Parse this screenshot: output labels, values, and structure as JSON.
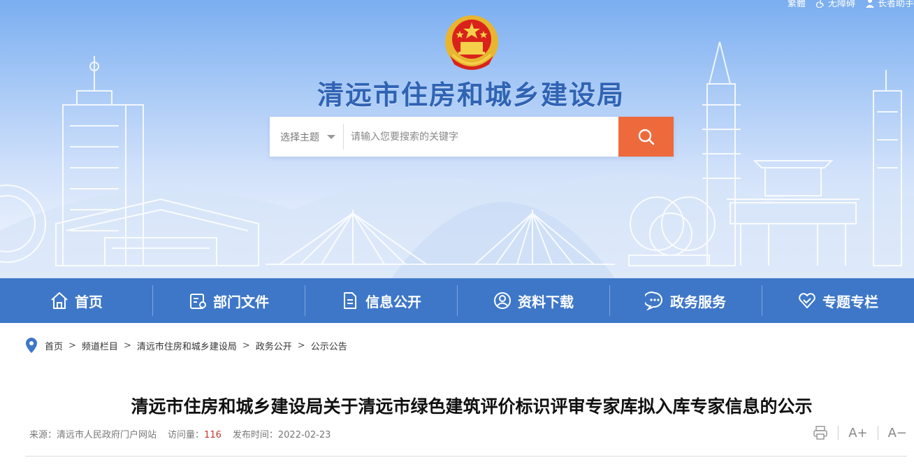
{
  "header": {
    "top_links": [
      {
        "label": "繁體",
        "icon": "traditional-chinese-icon"
      },
      {
        "label": "无障碍",
        "icon": "accessibility-icon"
      },
      {
        "label": "长者助手",
        "icon": "elder-assistant-icon"
      }
    ],
    "site_title": "清远市住房和城乡建设局",
    "search": {
      "topic_label": "选择主题",
      "placeholder": "请输入您要搜索的关键字",
      "button_icon": "search-icon"
    }
  },
  "nav": {
    "items": [
      {
        "label": "首页",
        "icon": "home-icon"
      },
      {
        "label": "部门文件",
        "icon": "document-list-icon"
      },
      {
        "label": "信息公开",
        "icon": "file-icon"
      },
      {
        "label": "资料下载",
        "icon": "user-download-icon"
      },
      {
        "label": "政务服务",
        "icon": "chat-service-icon"
      },
      {
        "label": "专题专栏",
        "icon": "heart-special-icon"
      }
    ]
  },
  "breadcrumb": {
    "items": [
      "首页",
      "频道栏目",
      "清远市住房和城乡建设局",
      "政务公开",
      "公示公告"
    ],
    "separator": ">"
  },
  "article": {
    "title": "清远市住房和城乡建设局关于清远市绿色建筑评价标识评审专家库拟入库专家信息的公示",
    "source_label": "来源：",
    "source_value": "清远市人民政府门户网站",
    "views_label": "访问量：",
    "views_value": "116",
    "date_label": "发布时间：",
    "date_value": "2022-02-23",
    "tools": {
      "print_icon": "print-icon",
      "font_increase": "A+",
      "font_decrease": "A−"
    }
  },
  "colors": {
    "nav_bg": "#3e77c8",
    "title_blue": "#2f63b4",
    "search_button": "#ee6a3d",
    "views_number": "#c0392b"
  }
}
